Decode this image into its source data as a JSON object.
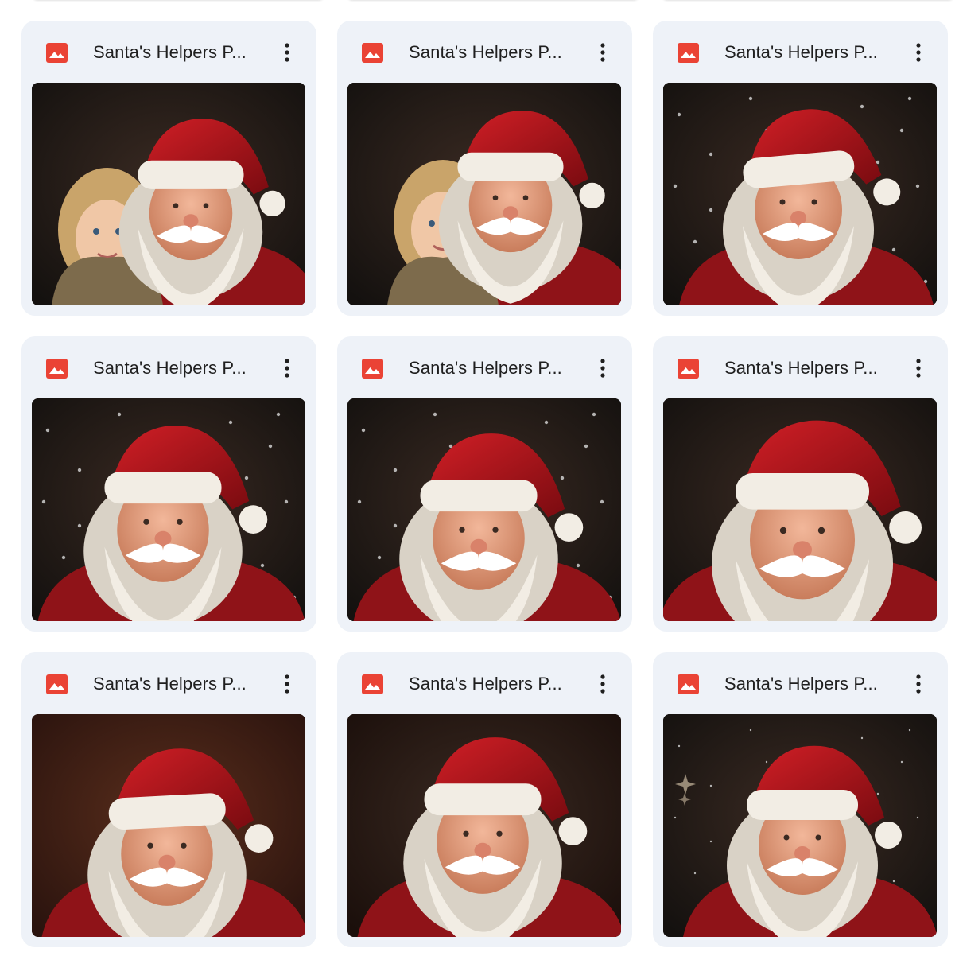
{
  "files": [
    {
      "name": "Santa's Helpers P...",
      "type_icon": "image-file-icon",
      "thumbnail": "santa-with-curly-haired-girl",
      "variant": "child"
    },
    {
      "name": "Santa's Helpers P...",
      "type_icon": "image-file-icon",
      "thumbnail": "santa-with-toddler",
      "variant": "child2"
    },
    {
      "name": "Santa's Helpers P...",
      "type_icon": "image-file-icon",
      "thumbnail": "santa-in-snow-holly",
      "variant": "snow"
    },
    {
      "name": "Santa's Helpers P...",
      "type_icon": "image-file-icon",
      "thumbnail": "santa-portrait-smiling",
      "variant": "plain"
    },
    {
      "name": "Santa's Helpers P...",
      "type_icon": "image-file-icon",
      "thumbnail": "santa-portrait-snowfall",
      "variant": "snow2"
    },
    {
      "name": "Santa's Helpers P...",
      "type_icon": "image-file-icon",
      "thumbnail": "santa-closeup-laughing",
      "variant": "close"
    },
    {
      "name": "Santa's Helpers P...",
      "type_icon": "image-file-icon",
      "thumbnail": "santa-portrait-warm-light",
      "variant": "plain2"
    },
    {
      "name": "Santa's Helpers P...",
      "type_icon": "image-file-icon",
      "thumbnail": "santa-portrait-dark",
      "variant": "plain3"
    },
    {
      "name": "Santa's Helpers P...",
      "type_icon": "image-file-icon",
      "thumbnail": "santa-looking-up-stars",
      "variant": "stars"
    }
  ],
  "colors": {
    "card_background": "#eef2f8",
    "image_icon_red": "#ea4335",
    "text_primary": "#1f1f1f",
    "hat_red": "#b3121b",
    "fur_white": "#f2ede4"
  },
  "menu_icon": "more-vert-icon"
}
